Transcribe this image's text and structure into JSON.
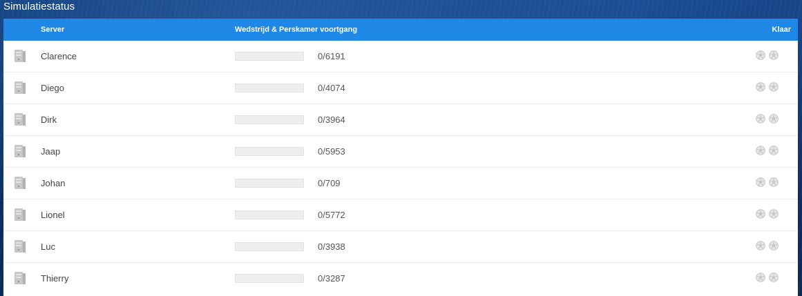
{
  "window": {
    "title": "Simulatiestatus"
  },
  "table": {
    "headers": {
      "server": "Server",
      "progress": "Wedstrijd & Perskamer voortgang",
      "ready": "Klaar"
    },
    "rows": [
      {
        "name": "Clarence",
        "progress_text": "0/6191",
        "progress_fraction": 0
      },
      {
        "name": "Diego",
        "progress_text": "0/4074",
        "progress_fraction": 0
      },
      {
        "name": "Dirk",
        "progress_text": "0/3964",
        "progress_fraction": 0
      },
      {
        "name": "Jaap",
        "progress_text": "0/5953",
        "progress_fraction": 0
      },
      {
        "name": "Johan",
        "progress_text": "0/709",
        "progress_fraction": 0
      },
      {
        "name": "Lionel",
        "progress_text": "0/5772",
        "progress_fraction": 0
      },
      {
        "name": "Luc",
        "progress_text": "0/3938",
        "progress_fraction": 0
      },
      {
        "name": "Thierry",
        "progress_text": "0/3287",
        "progress_fraction": 0
      }
    ]
  },
  "icons": {
    "server": "server-icon",
    "ready_match": "football-icon",
    "ready_press": "football-icon"
  },
  "colors": {
    "header_bg": "#1f87e5",
    "progress_track": "#eeeeee",
    "icon_gray": "#bdbdbd"
  }
}
